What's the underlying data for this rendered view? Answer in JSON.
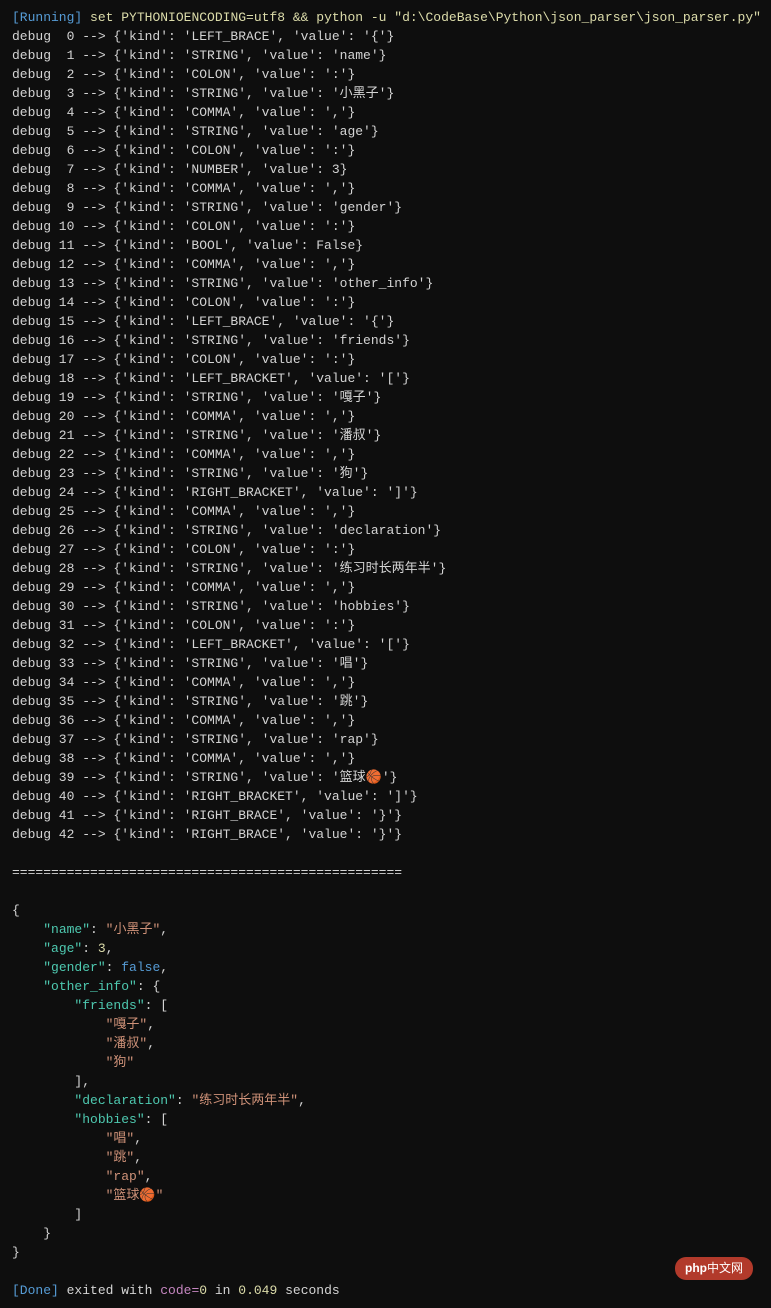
{
  "header": {
    "running_label": "[Running]",
    "command": "set PYTHONIOENCODING=utf8 && python -u \"d:\\CodeBase\\Python\\json_parser\\json_parser.py\""
  },
  "debug_prefix": "debug",
  "arrow": " --> ",
  "tokens": [
    {
      "idx": 0,
      "kind": "LEFT_BRACE",
      "value": "{"
    },
    {
      "idx": 1,
      "kind": "STRING",
      "value": "name"
    },
    {
      "idx": 2,
      "kind": "COLON",
      "value": ":"
    },
    {
      "idx": 3,
      "kind": "STRING",
      "value": "小黑子"
    },
    {
      "idx": 4,
      "kind": "COMMA",
      "value": ","
    },
    {
      "idx": 5,
      "kind": "STRING",
      "value": "age"
    },
    {
      "idx": 6,
      "kind": "COLON",
      "value": ":"
    },
    {
      "idx": 7,
      "kind": "NUMBER",
      "value": 3
    },
    {
      "idx": 8,
      "kind": "COMMA",
      "value": ","
    },
    {
      "idx": 9,
      "kind": "STRING",
      "value": "gender"
    },
    {
      "idx": 10,
      "kind": "COLON",
      "value": ":"
    },
    {
      "idx": 11,
      "kind": "BOOL",
      "value": false
    },
    {
      "idx": 12,
      "kind": "COMMA",
      "value": ","
    },
    {
      "idx": 13,
      "kind": "STRING",
      "value": "other_info"
    },
    {
      "idx": 14,
      "kind": "COLON",
      "value": ":"
    },
    {
      "idx": 15,
      "kind": "LEFT_BRACE",
      "value": "{"
    },
    {
      "idx": 16,
      "kind": "STRING",
      "value": "friends"
    },
    {
      "idx": 17,
      "kind": "COLON",
      "value": ":"
    },
    {
      "idx": 18,
      "kind": "LEFT_BRACKET",
      "value": "["
    },
    {
      "idx": 19,
      "kind": "STRING",
      "value": "嘎子"
    },
    {
      "idx": 20,
      "kind": "COMMA",
      "value": ","
    },
    {
      "idx": 21,
      "kind": "STRING",
      "value": "潘叔"
    },
    {
      "idx": 22,
      "kind": "COMMA",
      "value": ","
    },
    {
      "idx": 23,
      "kind": "STRING",
      "value": "狗"
    },
    {
      "idx": 24,
      "kind": "RIGHT_BRACKET",
      "value": "]"
    },
    {
      "idx": 25,
      "kind": "COMMA",
      "value": ","
    },
    {
      "idx": 26,
      "kind": "STRING",
      "value": "declaration"
    },
    {
      "idx": 27,
      "kind": "COLON",
      "value": ":"
    },
    {
      "idx": 28,
      "kind": "STRING",
      "value": "练习时长两年半"
    },
    {
      "idx": 29,
      "kind": "COMMA",
      "value": ","
    },
    {
      "idx": 30,
      "kind": "STRING",
      "value": "hobbies"
    },
    {
      "idx": 31,
      "kind": "COLON",
      "value": ":"
    },
    {
      "idx": 32,
      "kind": "LEFT_BRACKET",
      "value": "["
    },
    {
      "idx": 33,
      "kind": "STRING",
      "value": "唱"
    },
    {
      "idx": 34,
      "kind": "COMMA",
      "value": ","
    },
    {
      "idx": 35,
      "kind": "STRING",
      "value": "跳"
    },
    {
      "idx": 36,
      "kind": "COMMA",
      "value": ","
    },
    {
      "idx": 37,
      "kind": "STRING",
      "value": "rap"
    },
    {
      "idx": 38,
      "kind": "COMMA",
      "value": ","
    },
    {
      "idx": 39,
      "kind": "STRING",
      "value": "篮球🏀"
    },
    {
      "idx": 40,
      "kind": "RIGHT_BRACKET",
      "value": "]"
    },
    {
      "idx": 41,
      "kind": "RIGHT_BRACE",
      "value": "}"
    },
    {
      "idx": 42,
      "kind": "RIGHT_BRACE",
      "value": "}"
    }
  ],
  "separator": "==================================================",
  "json_output": [
    "{",
    "    \"name\": \"小黑子\",",
    "    \"age\": 3,",
    "    \"gender\": false,",
    "    \"other_info\": {",
    "        \"friends\": [",
    "            \"嘎子\",",
    "            \"潘叔\",",
    "            \"狗\"",
    "        ],",
    "        \"declaration\": \"练习时长两年半\",",
    "        \"hobbies\": [",
    "            \"唱\",",
    "            \"跳\",",
    "            \"rap\",",
    "            \"篮球🏀\"",
    "        ]",
    "    }",
    "}"
  ],
  "footer": {
    "done_label": "[Done]",
    "exited_text": " exited with ",
    "code_label": "code=",
    "code_value": "0",
    "in_text": " in ",
    "time": "0.049",
    "seconds_text": " seconds"
  },
  "watermark": {
    "prefix": "php",
    "suffix": "中文网"
  }
}
